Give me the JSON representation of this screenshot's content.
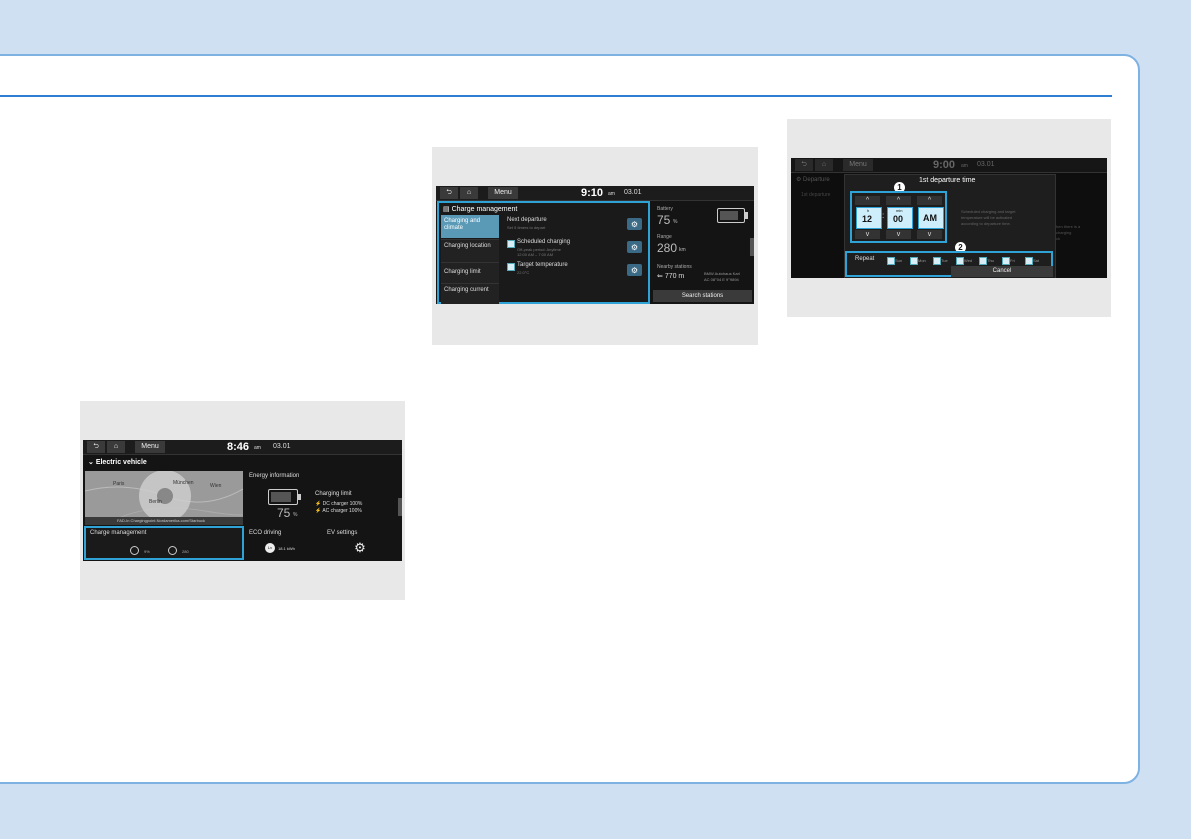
{
  "topbar": {
    "back_icon": "back-arrow-icon",
    "home_icon": "home-icon",
    "menu_label": "Menu"
  },
  "screen1": {
    "time": "8:46",
    "ampm": "am",
    "date": "03.01",
    "title": "Electric vehicle",
    "map_labels": [
      "München",
      "Paris",
      "Wien",
      "Berlin"
    ],
    "map_status": "FAD-In  Chargingpoint.Nordamerika.com/Starbuck",
    "energy_title": "Energy information",
    "battery_value": "75",
    "battery_unit": "%",
    "charging_limit_title": "Charging limit",
    "dc_limit": "DC charger 100%",
    "ac_limit": "AC charger 100%",
    "charge_management_title": "Charge management",
    "cm_val1": "9%",
    "cm_val2": "280",
    "eco_title": "ECO driving",
    "eco_badge": "Lv",
    "eco_value": "18.1 kWh",
    "ev_settings_title": "EV settings"
  },
  "screen2": {
    "time": "9:10",
    "ampm": "am",
    "date": "03.01",
    "header": "Charge management",
    "tabs": [
      "Charging and climate",
      "Charging location",
      "Charging limit",
      "Charging current"
    ],
    "next_departure": "Next departure",
    "next_departure_sub": "Set 5 timers to depart",
    "scheduled_charging": "Scheduled charging",
    "scheduled_sub1": "Off-peak period: Anytime",
    "scheduled_sub2": "12:00 AM – 7:00 AM",
    "target_temperature": "Target temperature",
    "target_sub": "22.0°C",
    "battery_label": "Battery",
    "battery_value": "75",
    "battery_unit": "%",
    "range_label": "Range",
    "range_value": "280",
    "range_unit": "km",
    "nearby_label": "Nearby stations",
    "nearby_distance": "770 m",
    "nearby_name": "BMW Autohaus Karl",
    "nearby_addr": "AC 08°04 E 9°9894",
    "search_button": "Search stations"
  },
  "screen3": {
    "time": "9:00",
    "ampm": "am",
    "date": "03.01",
    "bg_title": "Departure",
    "bg_item": "1st departure",
    "bg_text1": "Scheduled charging and target",
    "bg_text2": "temperature will be activated",
    "bg_text3": "according to departure time.",
    "bg_side1": "hen there is a",
    "bg_side2": "charging",
    "bg_side3": "ck",
    "popup_title": "1st departure time",
    "marker1": "1",
    "marker2": "2",
    "hour_label": "h",
    "hour_value": "12",
    "min_label": "min",
    "min_value": "00",
    "ampm_value": "AM",
    "repeat_label": "Repeat",
    "days": [
      "Sun",
      "Mon",
      "Tue",
      "Wed",
      "Thu",
      "Fri",
      "Sat"
    ],
    "cancel_button": "Cancel"
  },
  "colors": {
    "accent": "#2fa3d6",
    "page_border": "#7eb2e2",
    "rule": "#2e7fd1",
    "background": "#cfe0f3"
  }
}
